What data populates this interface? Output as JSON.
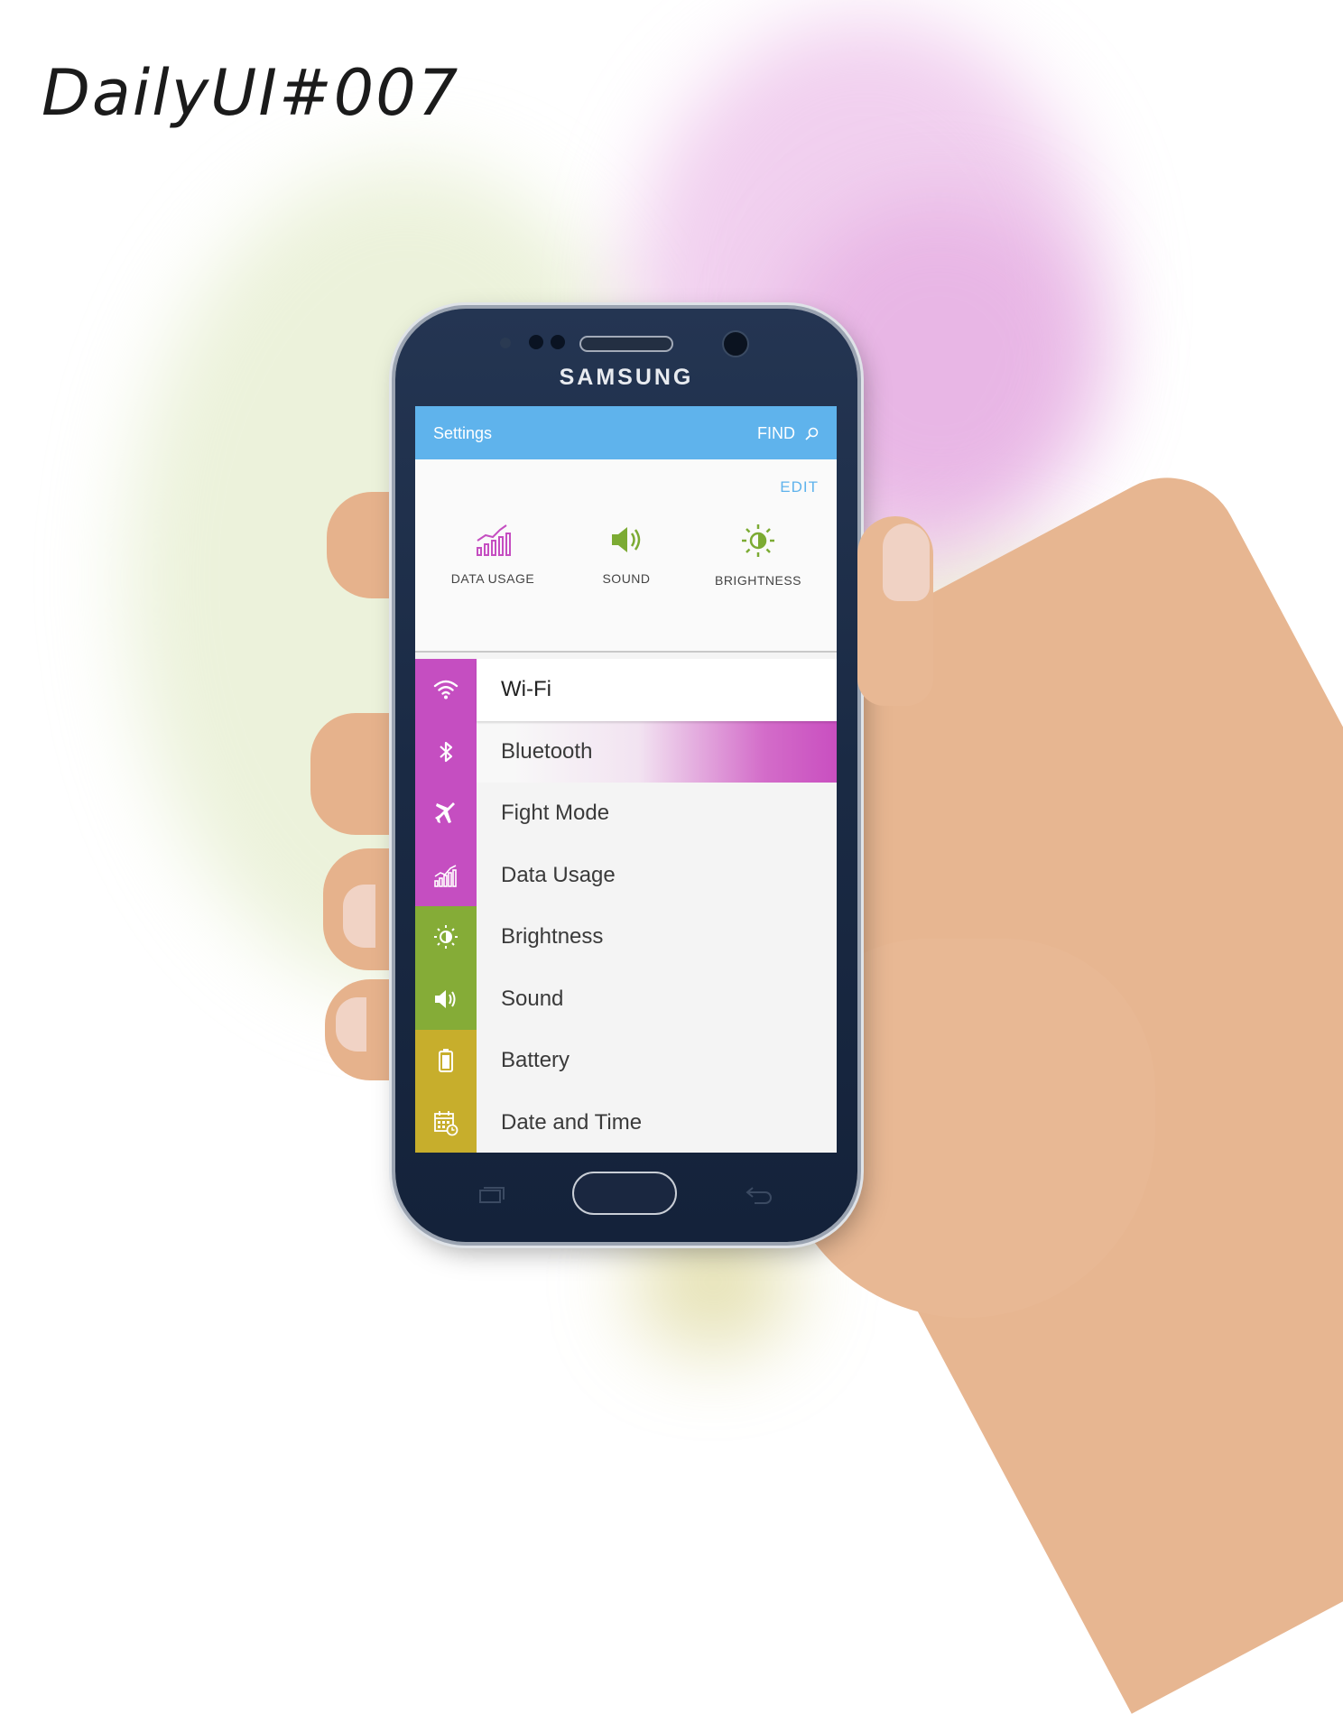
{
  "headline": "DailyUI#007",
  "device": {
    "brand": "SAMSUNG"
  },
  "appbar": {
    "title": "Settings",
    "find_label": "FIND",
    "find_icon": "search-icon"
  },
  "quick_settings": {
    "edit_label": "EDIT",
    "tiles": [
      {
        "label": "DATA USAGE",
        "icon": "data-usage-icon",
        "color": "#c54ec1"
      },
      {
        "label": "SOUND",
        "icon": "sound-icon",
        "color": "#7cab33"
      },
      {
        "label": "BRIGHTNESS",
        "icon": "brightness-icon",
        "color": "#7cab33"
      }
    ]
  },
  "settings_list": [
    {
      "label": "Wi-Fi",
      "icon": "wifi-icon",
      "color": "#c54ec1"
    },
    {
      "label": "Bluetooth",
      "icon": "bluetooth-icon",
      "color": "#c54ec1",
      "active": true
    },
    {
      "label": "Fight Mode",
      "icon": "airplane-icon",
      "color": "#c54ec1"
    },
    {
      "label": "Data Usage",
      "icon": "data-usage-icon",
      "color": "#c54ec1"
    },
    {
      "label": "Brightness",
      "icon": "brightness-icon",
      "color": "#85ac37"
    },
    {
      "label": "Sound",
      "icon": "sound-icon",
      "color": "#85ac37"
    },
    {
      "label": "Battery",
      "icon": "battery-icon",
      "color": "#c7ae2c"
    },
    {
      "label": "Date and Time",
      "icon": "calendar-icon",
      "color": "#c7ae2c"
    }
  ],
  "colors": {
    "accent": "#5fb3ec",
    "magenta": "#c54ec1",
    "green": "#85ac37",
    "olive": "#c7ae2c"
  }
}
